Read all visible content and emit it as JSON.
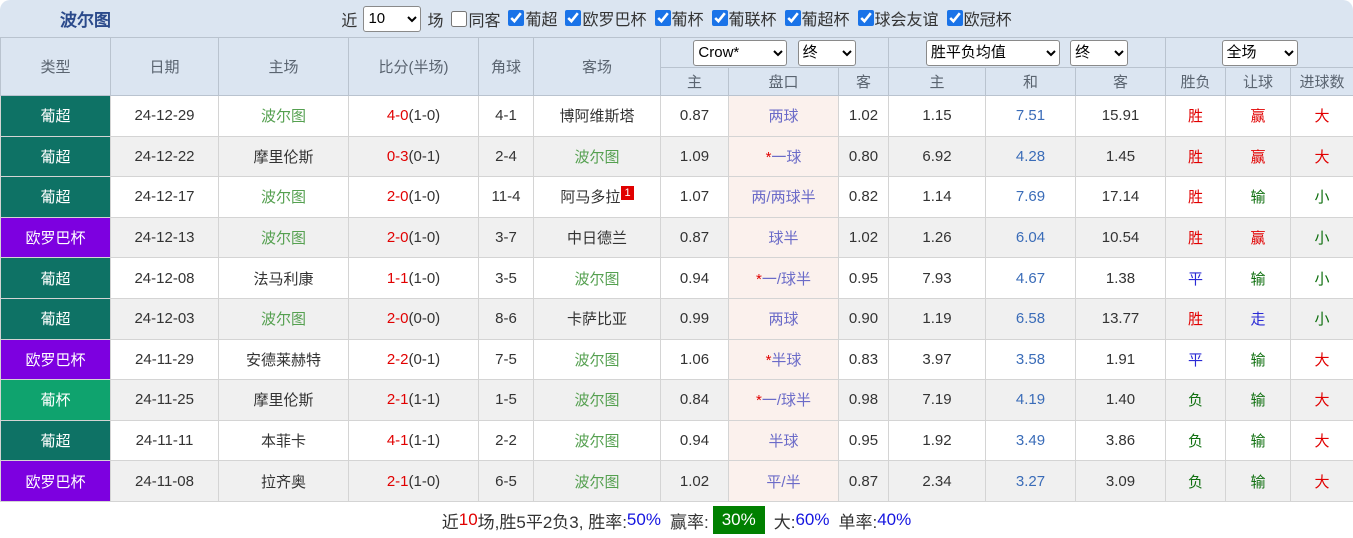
{
  "title": "波尔图",
  "topbar": {
    "recent_label": "近",
    "recent_value": "10",
    "games_label": "场",
    "same_venue_label": "同客",
    "same_venue_checked": false,
    "leagues": [
      {
        "label": "葡超",
        "checked": true
      },
      {
        "label": "欧罗巴杯",
        "checked": true
      },
      {
        "label": "葡杯",
        "checked": true
      },
      {
        "label": "葡联杯",
        "checked": true
      },
      {
        "label": "葡超杯",
        "checked": true
      },
      {
        "label": "球会友谊",
        "checked": true
      },
      {
        "label": "欧冠杯",
        "checked": true
      }
    ]
  },
  "colors": {
    "league_primeira": "#0e7265",
    "league_europa": "#7d00e0",
    "league_cup": "#0fa36e",
    "win": "#e10000",
    "draw": "#2a2ad5",
    "lose": "#107010",
    "badge_green": "#008000",
    "header_bg": "#dbe5f1"
  },
  "table": {
    "header": {
      "main_columns": [
        "类型",
        "日期",
        "主场",
        "比分(半场)",
        "角球",
        "客场"
      ],
      "sub_columns": [
        "主",
        "盘口",
        "客",
        "主",
        "和",
        "客"
      ],
      "result_columns": [
        "胜负",
        "让球",
        "进球数"
      ]
    },
    "selects": {
      "bookmaker": "Crow*",
      "time1": "终",
      "odds_type": "胜平负均值",
      "time2": "终",
      "scope": "全场"
    },
    "rows": [
      {
        "type": "葡超",
        "type_bg": "#0e7265",
        "date": "24-12-29",
        "home": "波尔图",
        "home_team": true,
        "score": "4-0",
        "half": "(1-0)",
        "corner": "4-1",
        "away": "博阿维斯塔",
        "away_team": false,
        "away_sup": "",
        "h_home": "0.87",
        "star": "",
        "handicap": "两球",
        "h_away": "1.02",
        "o_home": "1.15",
        "o_draw": "7.51",
        "o_away": "15.91",
        "result": "胜",
        "result_color": "red",
        "hcp": "赢",
        "hcp_color": "red",
        "goals": "大",
        "goals_color": "red"
      },
      {
        "type": "葡超",
        "type_bg": "#0e7265",
        "date": "24-12-22",
        "home": "摩里伦斯",
        "home_team": false,
        "score": "0-3",
        "half": "(0-1)",
        "corner": "2-4",
        "away": "波尔图",
        "away_team": true,
        "away_sup": "",
        "h_home": "1.09",
        "star": "*",
        "handicap": "一球",
        "h_away": "0.80",
        "o_home": "6.92",
        "o_draw": "4.28",
        "o_away": "1.45",
        "result": "胜",
        "result_color": "red",
        "hcp": "赢",
        "hcp_color": "red",
        "goals": "大",
        "goals_color": "red"
      },
      {
        "type": "葡超",
        "type_bg": "#0e7265",
        "date": "24-12-17",
        "home": "波尔图",
        "home_team": true,
        "score": "2-0",
        "half": "(1-0)",
        "corner": "11-4",
        "away": "阿马多拉",
        "away_team": false,
        "away_sup": "1",
        "h_home": "1.07",
        "star": "",
        "handicap": "两/两球半",
        "h_away": "0.82",
        "o_home": "1.14",
        "o_draw": "7.69",
        "o_away": "17.14",
        "result": "胜",
        "result_color": "red",
        "hcp": "输",
        "hcp_color": "green",
        "goals": "小",
        "goals_color": "green"
      },
      {
        "type": "欧罗巴杯",
        "type_bg": "#7d00e0",
        "date": "24-12-13",
        "home": "波尔图",
        "home_team": true,
        "score": "2-0",
        "half": "(1-0)",
        "corner": "3-7",
        "away": "中日德兰",
        "away_team": false,
        "away_sup": "",
        "h_home": "0.87",
        "star": "",
        "handicap": "球半",
        "h_away": "1.02",
        "o_home": "1.26",
        "o_draw": "6.04",
        "o_away": "10.54",
        "result": "胜",
        "result_color": "red",
        "hcp": "赢",
        "hcp_color": "red",
        "goals": "小",
        "goals_color": "green"
      },
      {
        "type": "葡超",
        "type_bg": "#0e7265",
        "date": "24-12-08",
        "home": "法马利康",
        "home_team": false,
        "score": "1-1",
        "half": "(1-0)",
        "corner": "3-5",
        "away": "波尔图",
        "away_team": true,
        "away_sup": "",
        "h_home": "0.94",
        "star": "*",
        "handicap": "一/球半",
        "h_away": "0.95",
        "o_home": "7.93",
        "o_draw": "4.67",
        "o_away": "1.38",
        "result": "平",
        "result_color": "blue",
        "hcp": "输",
        "hcp_color": "green",
        "goals": "小",
        "goals_color": "green"
      },
      {
        "type": "葡超",
        "type_bg": "#0e7265",
        "date": "24-12-03",
        "home": "波尔图",
        "home_team": true,
        "score": "2-0",
        "half": "(0-0)",
        "corner": "8-6",
        "away": "卡萨比亚",
        "away_team": false,
        "away_sup": "",
        "h_home": "0.99",
        "star": "",
        "handicap": "两球",
        "h_away": "0.90",
        "o_home": "1.19",
        "o_draw": "6.58",
        "o_away": "13.77",
        "result": "胜",
        "result_color": "red",
        "hcp": "走",
        "hcp_color": "blue",
        "goals": "小",
        "goals_color": "green"
      },
      {
        "type": "欧罗巴杯",
        "type_bg": "#7d00e0",
        "date": "24-11-29",
        "home": "安德莱赫特",
        "home_team": false,
        "score": "2-2",
        "half": "(0-1)",
        "corner": "7-5",
        "away": "波尔图",
        "away_team": true,
        "away_sup": "",
        "h_home": "1.06",
        "star": "*",
        "handicap": "半球",
        "h_away": "0.83",
        "o_home": "3.97",
        "o_draw": "3.58",
        "o_away": "1.91",
        "result": "平",
        "result_color": "blue",
        "hcp": "输",
        "hcp_color": "green",
        "goals": "大",
        "goals_color": "red"
      },
      {
        "type": "葡杯",
        "type_bg": "#0fa36e",
        "date": "24-11-25",
        "home": "摩里伦斯",
        "home_team": false,
        "score": "2-1",
        "half": "(1-1)",
        "corner": "1-5",
        "away": "波尔图",
        "away_team": true,
        "away_sup": "",
        "h_home": "0.84",
        "star": "*",
        "handicap": "一/球半",
        "h_away": "0.98",
        "o_home": "7.19",
        "o_draw": "4.19",
        "o_away": "1.40",
        "result": "负",
        "result_color": "green",
        "hcp": "输",
        "hcp_color": "green",
        "goals": "大",
        "goals_color": "red"
      },
      {
        "type": "葡超",
        "type_bg": "#0e7265",
        "date": "24-11-11",
        "home": "本菲卡",
        "home_team": false,
        "score": "4-1",
        "half": "(1-1)",
        "corner": "2-2",
        "away": "波尔图",
        "away_team": true,
        "away_sup": "",
        "h_home": "0.94",
        "star": "",
        "handicap": "半球",
        "h_away": "0.95",
        "o_home": "1.92",
        "o_draw": "3.49",
        "o_away": "3.86",
        "result": "负",
        "result_color": "green",
        "hcp": "输",
        "hcp_color": "green",
        "goals": "大",
        "goals_color": "red"
      },
      {
        "type": "欧罗巴杯",
        "type_bg": "#7d00e0",
        "date": "24-11-08",
        "home": "拉齐奥",
        "home_team": false,
        "score": "2-1",
        "half": "(1-0)",
        "corner": "6-5",
        "away": "波尔图",
        "away_team": true,
        "away_sup": "",
        "h_home": "1.02",
        "star": "",
        "handicap": "平/半",
        "h_away": "0.87",
        "o_home": "2.34",
        "o_draw": "3.27",
        "o_away": "3.09",
        "result": "负",
        "result_color": "green",
        "hcp": "输",
        "hcp_color": "green",
        "goals": "大",
        "goals_color": "red"
      }
    ]
  },
  "footer": {
    "prefix": "近",
    "count": "10",
    "summary": "场,胜5平2负3, 胜率:",
    "win_rate": "50%",
    "handicap_label": "赢率:",
    "handicap_rate": "30%",
    "big_label": "大:",
    "big_rate": "60%",
    "single_label": "单率:",
    "single_rate": "40%"
  }
}
